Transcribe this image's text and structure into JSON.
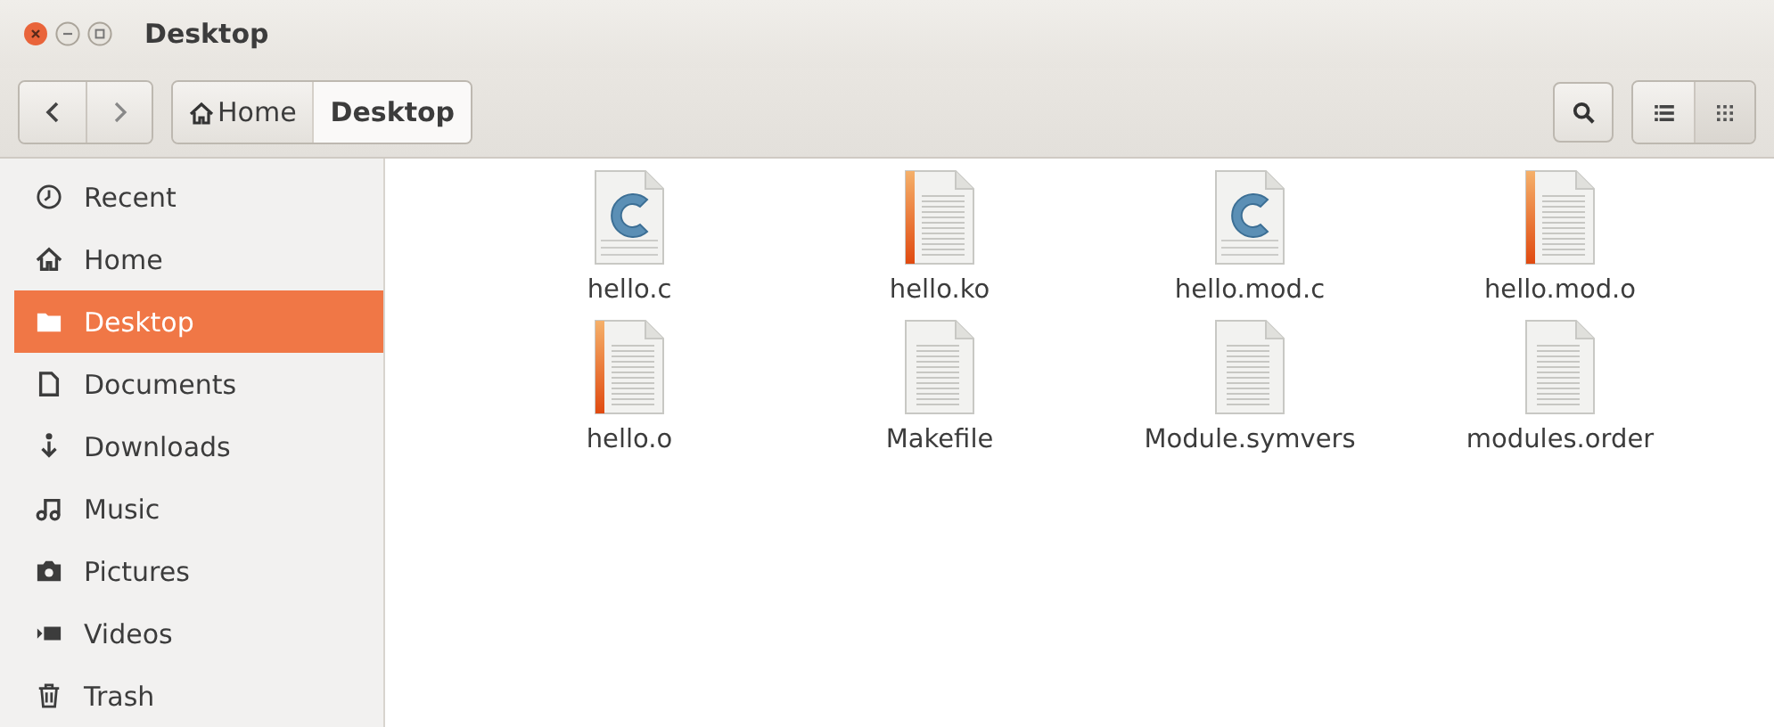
{
  "window": {
    "title": "Desktop"
  },
  "toolbar": {
    "breadcrumbs": [
      {
        "label": "Home",
        "kind": "home",
        "selected": false
      },
      {
        "label": "Desktop",
        "kind": "folder",
        "selected": true
      }
    ],
    "view_buttons": [
      {
        "kind": "list",
        "selected": false
      },
      {
        "kind": "grid",
        "selected": true
      }
    ]
  },
  "sidebar": {
    "items": [
      {
        "label": "Recent",
        "kind": "recent",
        "selected": false
      },
      {
        "label": "Home",
        "kind": "home",
        "selected": false
      },
      {
        "label": "Desktop",
        "kind": "desktop",
        "selected": true
      },
      {
        "label": "Documents",
        "kind": "documents",
        "selected": false
      },
      {
        "label": "Downloads",
        "kind": "downloads",
        "selected": false
      },
      {
        "label": "Music",
        "kind": "music",
        "selected": false
      },
      {
        "label": "Pictures",
        "kind": "pictures",
        "selected": false
      },
      {
        "label": "Videos",
        "kind": "videos",
        "selected": false
      },
      {
        "label": "Trash",
        "kind": "trash",
        "selected": false
      }
    ]
  },
  "files": [
    {
      "name": "hello.c",
      "kind": "c"
    },
    {
      "name": "hello.ko",
      "kind": "binary"
    },
    {
      "name": "hello.mod.c",
      "kind": "c"
    },
    {
      "name": "hello.mod.o",
      "kind": "binary"
    },
    {
      "name": "hello.o",
      "kind": "binary"
    },
    {
      "name": "Makefile",
      "kind": "text"
    },
    {
      "name": "Module.symvers",
      "kind": "text"
    },
    {
      "name": "modules.order",
      "kind": "text"
    }
  ]
}
